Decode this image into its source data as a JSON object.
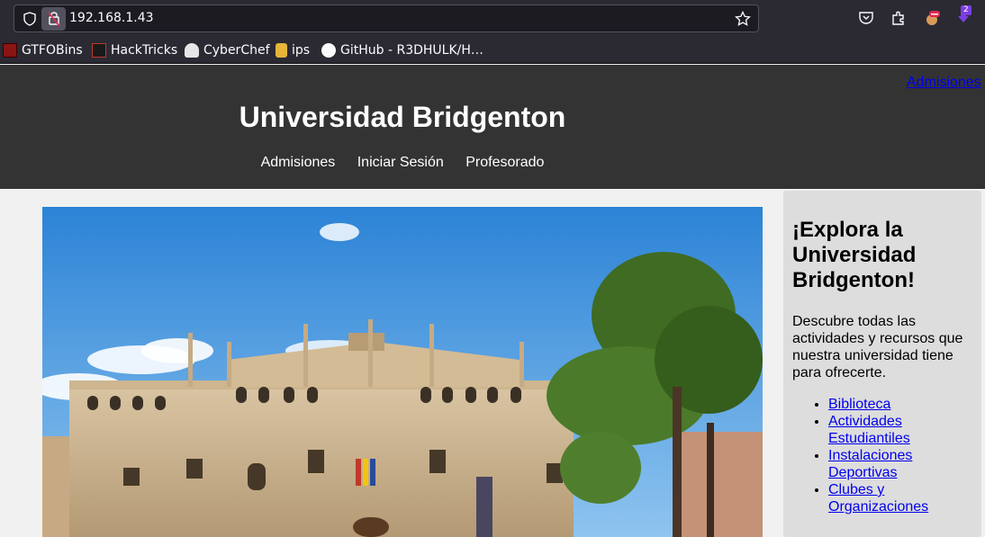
{
  "browser": {
    "url": "192.168.1.43",
    "extension_badge": "2",
    "bookmarks": [
      {
        "label": "GTFOBins",
        "icon": "gtfobins-favicon"
      },
      {
        "label": "HackTricks",
        "icon": "hacktricks-favicon"
      },
      {
        "label": "CyberChef",
        "icon": "cyberchef-favicon"
      },
      {
        "label": "ips",
        "icon": "ips-favicon"
      },
      {
        "label": "GitHub - R3DHULK/H…",
        "icon": "github-favicon"
      }
    ]
  },
  "site": {
    "top_link": "Admisiones",
    "title": "Universidad Bridgenton",
    "nav": [
      "Admisiones",
      "Iniciar Sesión",
      "Profesorado"
    ]
  },
  "aside": {
    "heading": "¡Explora la Universidad Bridgenton!",
    "description": "Descubre todas las actividades y recursos que nuestra universidad tiene para ofrecerte.",
    "links": [
      "Biblioteca",
      "Actividades Estudiantiles",
      "Instalaciones Deportivas",
      "Clubes y Organizaciones"
    ]
  },
  "colors": {
    "header_bg": "#333333",
    "aside_bg": "#dddddd",
    "link": "#0000ee",
    "browser_bg": "#2b2a33"
  }
}
